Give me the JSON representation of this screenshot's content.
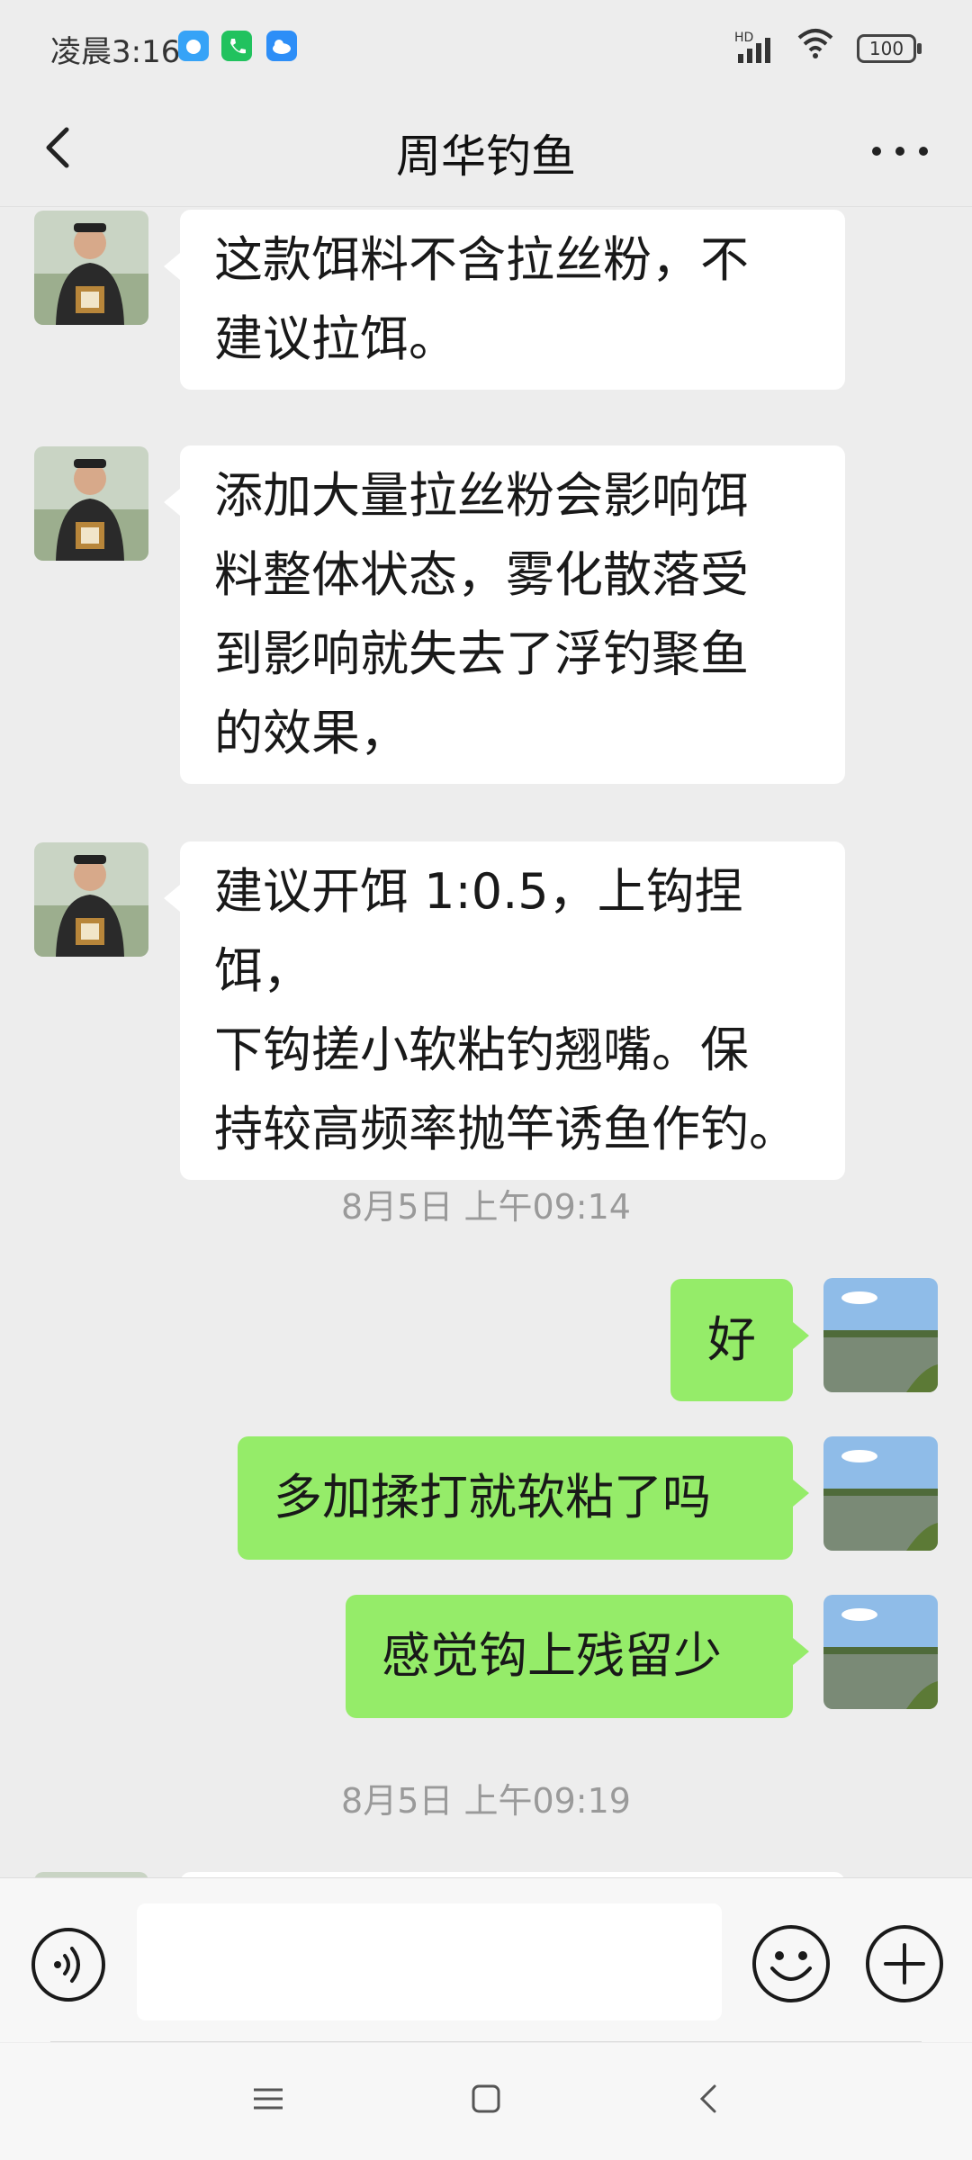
{
  "status_bar": {
    "time": "凌晨3:16",
    "network": "HD",
    "battery": "100"
  },
  "header": {
    "title": "周华钓鱼"
  },
  "messages": [
    {
      "side": "in",
      "text_lines": [
        "这款饵料不含拉丝粉，不",
        "建议拉饵。"
      ]
    },
    {
      "side": "in",
      "text_lines": [
        "添加大量拉丝粉会影响饵",
        "料整体状态，雾化散落受",
        "到影响就失去了浮钓聚鱼",
        "的效果，"
      ]
    },
    {
      "side": "in",
      "text_lines": [
        "建议开饵 1:0.5，上钩捏饵，",
        "下钩搓小软粘钓翘嘴。保",
        "持较高频率抛竿诱鱼作钓。"
      ]
    },
    {
      "timestamp": "8月5日 上午09:14"
    },
    {
      "side": "out",
      "text": "好"
    },
    {
      "side": "out",
      "text": "多加揉打就软粘了吗"
    },
    {
      "side": "out",
      "text": "感觉钩上残留少"
    },
    {
      "timestamp": "8月5日 上午09:19"
    }
  ],
  "colors": {
    "incoming_bubble": "#ffffff",
    "outgoing_bubble": "#95ec69",
    "background": "#ededed"
  },
  "icons": {
    "back": "chevron-left-icon",
    "more": "more-dots-icon",
    "voice": "voice-icon",
    "emoji": "emoji-icon",
    "plus": "plus-icon"
  }
}
